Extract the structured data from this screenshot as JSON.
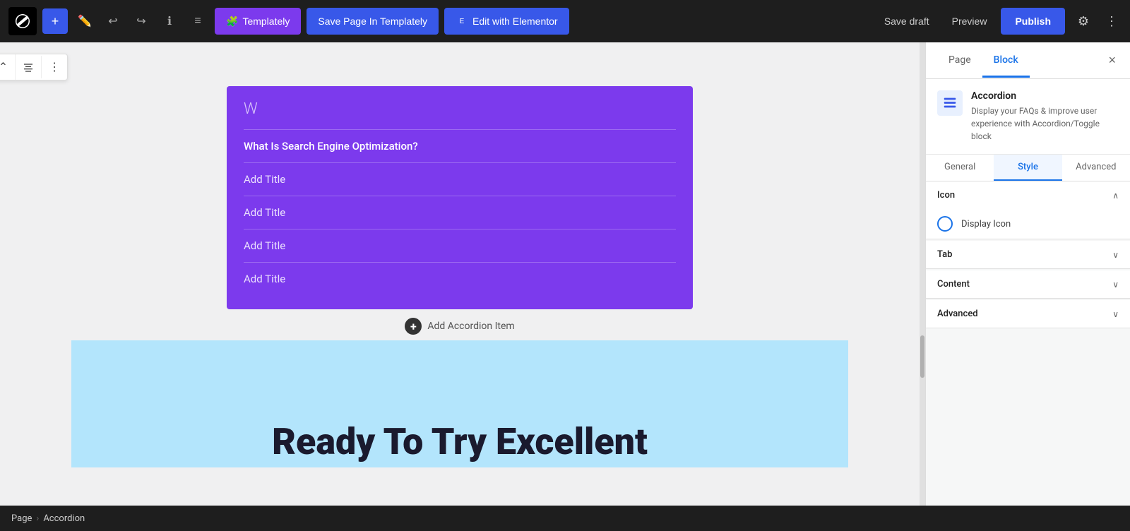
{
  "toolbar": {
    "add_label": "+",
    "undo_label": "↩",
    "redo_label": "↪",
    "info_label": "ℹ",
    "list_label": "≡",
    "templately_label": "Templately",
    "save_page_label": "Save Page In Templately",
    "edit_elementor_label": "Edit with Elementor",
    "save_draft_label": "Save draft",
    "preview_label": "Preview",
    "publish_label": "Publish"
  },
  "panel": {
    "page_tab": "Page",
    "block_tab": "Block",
    "close_label": "×",
    "block_name": "Accordion",
    "block_description": "Display your FAQs & improve user experience with Accordion/Toggle block",
    "tabs": [
      "General",
      "Style",
      "Advanced"
    ],
    "active_tab": "Style",
    "sections": [
      {
        "id": "icon",
        "title": "Icon",
        "expanded": true
      },
      {
        "id": "tab",
        "title": "Tab",
        "expanded": false
      },
      {
        "id": "content",
        "title": "Content",
        "expanded": false
      },
      {
        "id": "advanced",
        "title": "Advanced",
        "expanded": false
      }
    ],
    "display_icon_label": "Display Icon"
  },
  "accordion": {
    "letter": "W",
    "items": [
      {
        "label": "What Is Search Engine Optimization?",
        "active": true
      },
      {
        "label": "Add Title",
        "active": false
      },
      {
        "label": "Add Title",
        "active": false
      },
      {
        "label": "Add Title",
        "active": false
      },
      {
        "label": "Add Title",
        "active": false
      }
    ],
    "add_label": "Add Accordion Item"
  },
  "blue_section": {
    "text": "Ready To Try Excellent"
  },
  "breadcrumb": {
    "page": "Page",
    "sep": "›",
    "block": "Accordion"
  }
}
